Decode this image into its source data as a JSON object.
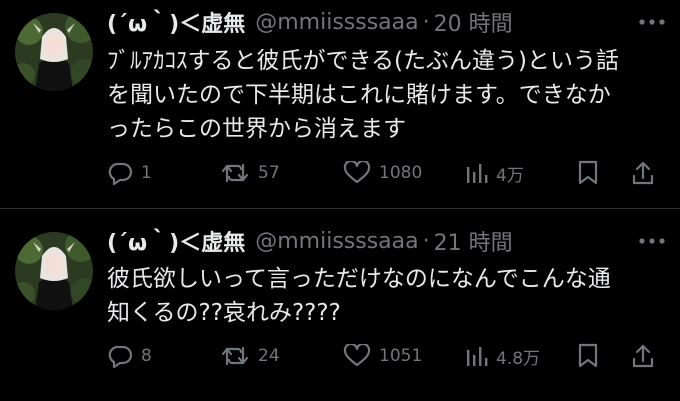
{
  "colors": {
    "background": "#000000",
    "text_primary": "#e7e9ea",
    "text_secondary": "#71767b",
    "divider": "#2f3336"
  },
  "tweets": [
    {
      "display_name": "(´ω｀)＜虚無",
      "handle": "@mmiissssaaa",
      "separator": "·",
      "time": "20 時間",
      "text": "ﾌﾞﾙｱｶｺｽすると彼氏ができる(たぶん違う)という話\nを聞いたので下半期はこれに賭けます。できなか\nったらこの世界から消えます",
      "reply_count": "1",
      "retweet_count": "57",
      "like_count": "1080",
      "view_count": "4万",
      "icons": [
        "reply-icon",
        "retweet-icon",
        "like-icon",
        "views-icon",
        "bookmark-icon",
        "share-icon",
        "more-icon"
      ]
    },
    {
      "display_name": "(´ω｀)＜虚無",
      "handle": "@mmiissssaaa",
      "separator": "·",
      "time": "21 時間",
      "text": "彼氏欲しいって言っただけなのになんでこんな通\n知くるの??哀れみ????",
      "reply_count": "8",
      "retweet_count": "24",
      "like_count": "1051",
      "view_count": "4.8万",
      "icons": [
        "reply-icon",
        "retweet-icon",
        "like-icon",
        "views-icon",
        "bookmark-icon",
        "share-icon",
        "more-icon"
      ]
    }
  ]
}
